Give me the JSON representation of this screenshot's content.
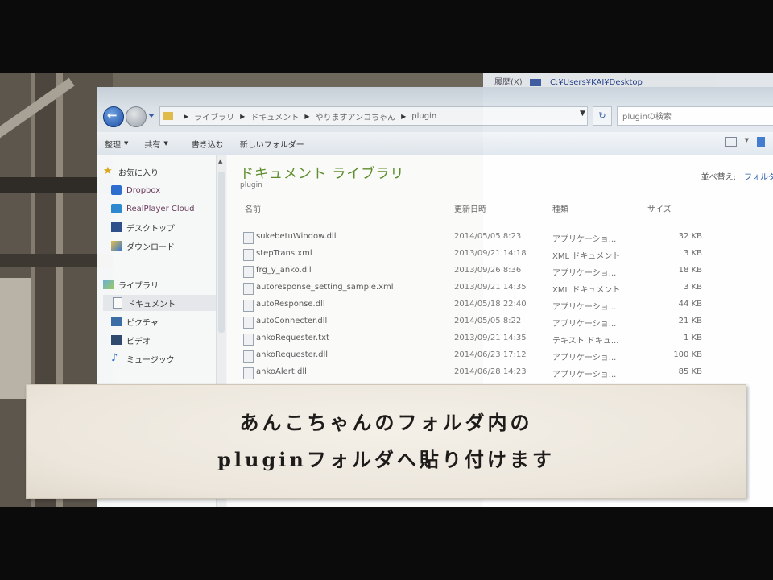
{
  "background_window": {
    "history_label": "履歴(X)",
    "path": "C:¥Users¥KAI¥Desktop"
  },
  "explorer": {
    "address": {
      "crumbs": [
        "ライブラリ",
        "ドキュメント",
        "やりますアンコちゃん",
        "plugin"
      ],
      "dropdown_glyph": "▼",
      "refresh_glyph": "↻"
    },
    "search": {
      "placeholder": "pluginの検索"
    },
    "toolbar": {
      "organize_label": "整理",
      "share_label": "共有",
      "burn_label": "書き込む",
      "new_folder_label": "新しいフォルダー",
      "dropdown_glyph": "▼"
    },
    "sidebar": {
      "favorites_label": "お気に入り",
      "favorites": [
        "Dropbox",
        "RealPlayer Cloud",
        "デスクトップ",
        "ダウンロード"
      ],
      "libraries_label": "ライブラリ",
      "libraries": [
        "ドキュメント",
        "ピクチャ",
        "ビデオ",
        "ミュージック"
      ],
      "selected": "ドキュメント"
    },
    "content": {
      "title": "ドキュメント ライブラリ",
      "subtitle": "plugin",
      "arrange_label": "並べ替え:",
      "arrange_value": "フォルダー",
      "columns": {
        "name": "名前",
        "date": "更新日時",
        "type": "種類",
        "size": "サイズ"
      },
      "files": [
        {
          "name": "sukebetuWindow.dll",
          "date": "2014/05/05 8:23",
          "type": "アプリケーショ...",
          "size": "32 KB"
        },
        {
          "name": "stepTrans.xml",
          "date": "2013/09/21 14:18",
          "type": "XML ドキュメント",
          "size": "3 KB"
        },
        {
          "name": "frg_y_anko.dll",
          "date": "2013/09/26 8:36",
          "type": "アプリケーショ...",
          "size": "18 KB"
        },
        {
          "name": "autoresponse_setting_sample.xml",
          "date": "2013/09/21 14:35",
          "type": "XML ドキュメント",
          "size": "3 KB"
        },
        {
          "name": "autoResponse.dll",
          "date": "2014/05/18 22:40",
          "type": "アプリケーショ...",
          "size": "44 KB"
        },
        {
          "name": "autoConnecter.dll",
          "date": "2014/05/05 8:22",
          "type": "アプリケーショ...",
          "size": "21 KB"
        },
        {
          "name": "ankoRequester.txt",
          "date": "2013/09/21 14:35",
          "type": "テキスト ドキュ...",
          "size": "1 KB"
        },
        {
          "name": "ankoRequester.dll",
          "date": "2014/06/23 17:12",
          "type": "アプリケーショ...",
          "size": "100 KB"
        },
        {
          "name": "ankoAlert.dll",
          "date": "2014/06/28 14:23",
          "type": "アプリケーショ...",
          "size": "85 KB"
        }
      ]
    }
  },
  "caption": {
    "line1": "あんこちゃんのフォルダ内の",
    "line2": "pluginフォルダへ貼り付けます"
  }
}
